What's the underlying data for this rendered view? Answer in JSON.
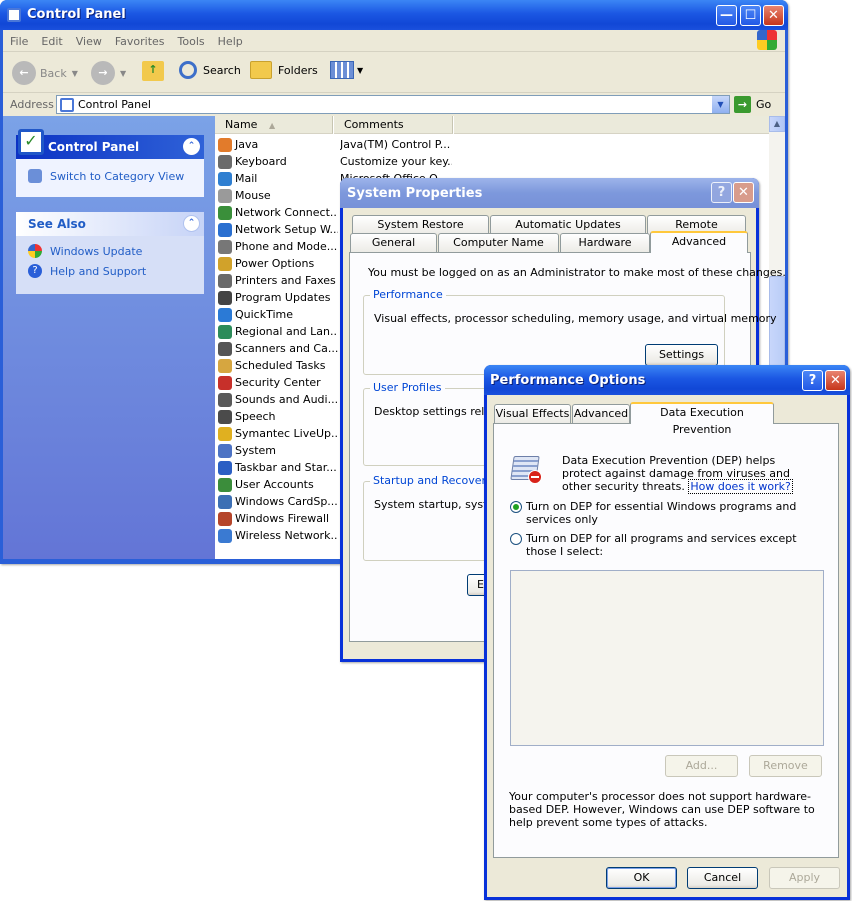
{
  "control_panel": {
    "title": "Control Panel",
    "menu": [
      "File",
      "Edit",
      "View",
      "Favorites",
      "Tools",
      "Help"
    ],
    "toolbar": {
      "back": "Back",
      "search": "Search",
      "folders": "Folders"
    },
    "address": {
      "label": "Address",
      "value": "Control Panel",
      "go": "Go"
    },
    "left_pane": {
      "panel_title": "Control Panel",
      "switch_link": "Switch to Category View",
      "see_also_title": "See Also",
      "see_also_links": [
        "Windows Update",
        "Help and Support"
      ]
    },
    "columns": {
      "name": "Name",
      "comments": "Comments"
    },
    "items": [
      {
        "name": "Java",
        "comment": "Java(TM) Control P...",
        "icon_color": "#e27b2b"
      },
      {
        "name": "Keyboard",
        "comment": "Customize your key...",
        "icon_color": "#6b6b6b"
      },
      {
        "name": "Mail",
        "comment": "Microsoft Office O...",
        "icon_color": "#2f7fd1"
      },
      {
        "name": "Mouse",
        "comment": "",
        "icon_color": "#9a9a9a"
      },
      {
        "name": "Network Connect...",
        "comment": "",
        "icon_color": "#3a8f3a"
      },
      {
        "name": "Network Setup W...",
        "comment": "",
        "icon_color": "#2a6fd0"
      },
      {
        "name": "Phone and Mode...",
        "comment": "",
        "icon_color": "#777777"
      },
      {
        "name": "Power Options",
        "comment": "",
        "icon_color": "#d1a22a"
      },
      {
        "name": "Printers and Faxes",
        "comment": "",
        "icon_color": "#6a6a6a"
      },
      {
        "name": "Program Updates",
        "comment": "",
        "icon_color": "#444444"
      },
      {
        "name": "QuickTime",
        "comment": "",
        "icon_color": "#2b7ad6"
      },
      {
        "name": "Regional and Lan...",
        "comment": "",
        "icon_color": "#2c8c5a"
      },
      {
        "name": "Scanners and Ca...",
        "comment": "",
        "icon_color": "#555555"
      },
      {
        "name": "Scheduled Tasks",
        "comment": "",
        "icon_color": "#d6a640"
      },
      {
        "name": "Security Center",
        "comment": "",
        "icon_color": "#c7302a"
      },
      {
        "name": "Sounds and Audi...",
        "comment": "",
        "icon_color": "#5a5a5a"
      },
      {
        "name": "Speech",
        "comment": "",
        "icon_color": "#4b4b4b"
      },
      {
        "name": "Symantec LiveUp...",
        "comment": "",
        "icon_color": "#e0b020"
      },
      {
        "name": "System",
        "comment": "",
        "icon_color": "#4d73c4"
      },
      {
        "name": "Taskbar and Star...",
        "comment": "",
        "icon_color": "#2b5fc4"
      },
      {
        "name": "User Accounts",
        "comment": "",
        "icon_color": "#3b8d3b"
      },
      {
        "name": "Windows CardSp...",
        "comment": "",
        "icon_color": "#3c6fb4"
      },
      {
        "name": "Windows Firewall",
        "comment": "",
        "icon_color": "#b5452a"
      },
      {
        "name": "Wireless Network...",
        "comment": "",
        "icon_color": "#3a7ad2"
      }
    ]
  },
  "system_properties": {
    "title": "System Properties",
    "tabs_back": [
      "System Restore",
      "Automatic Updates",
      "Remote"
    ],
    "tabs_front": [
      "General",
      "Computer Name",
      "Hardware",
      "Advanced"
    ],
    "admin_note": "You must be logged on as an Administrator to make most of these changes.",
    "performance": {
      "title": "Performance",
      "desc": "Visual effects, processor scheduling, memory usage, and virtual memory",
      "settings": "Settings"
    },
    "user_profiles": {
      "title": "User Profiles",
      "desc": "Desktop settings related"
    },
    "startup": {
      "title": "Startup and Recovery",
      "desc": "System startup, system"
    },
    "partial_button": "E"
  },
  "performance_options": {
    "title": "Performance Options",
    "tabs": [
      "Visual Effects",
      "Advanced",
      "Data Execution Prevention"
    ],
    "dep_desc": "Data Execution Prevention (DEP) helps protect against damage from viruses and other security threats.",
    "how_link": "How does it work?",
    "option1": "Turn on DEP for essential Windows programs and services only",
    "option2": "Turn on DEP for all programs and services except those I select:",
    "add": "Add...",
    "remove": "Remove",
    "note": "Your computer's processor does not support hardware-based DEP. However, Windows can use DEP software to help prevent some types of attacks.",
    "ok": "OK",
    "cancel": "Cancel",
    "apply": "Apply"
  },
  "colors": {
    "xp_blue": "#2a5fd8",
    "face": "#ece9d8",
    "link": "#215dc6",
    "group_title": "#0046d5",
    "tab_hot": "#ffc83c"
  }
}
